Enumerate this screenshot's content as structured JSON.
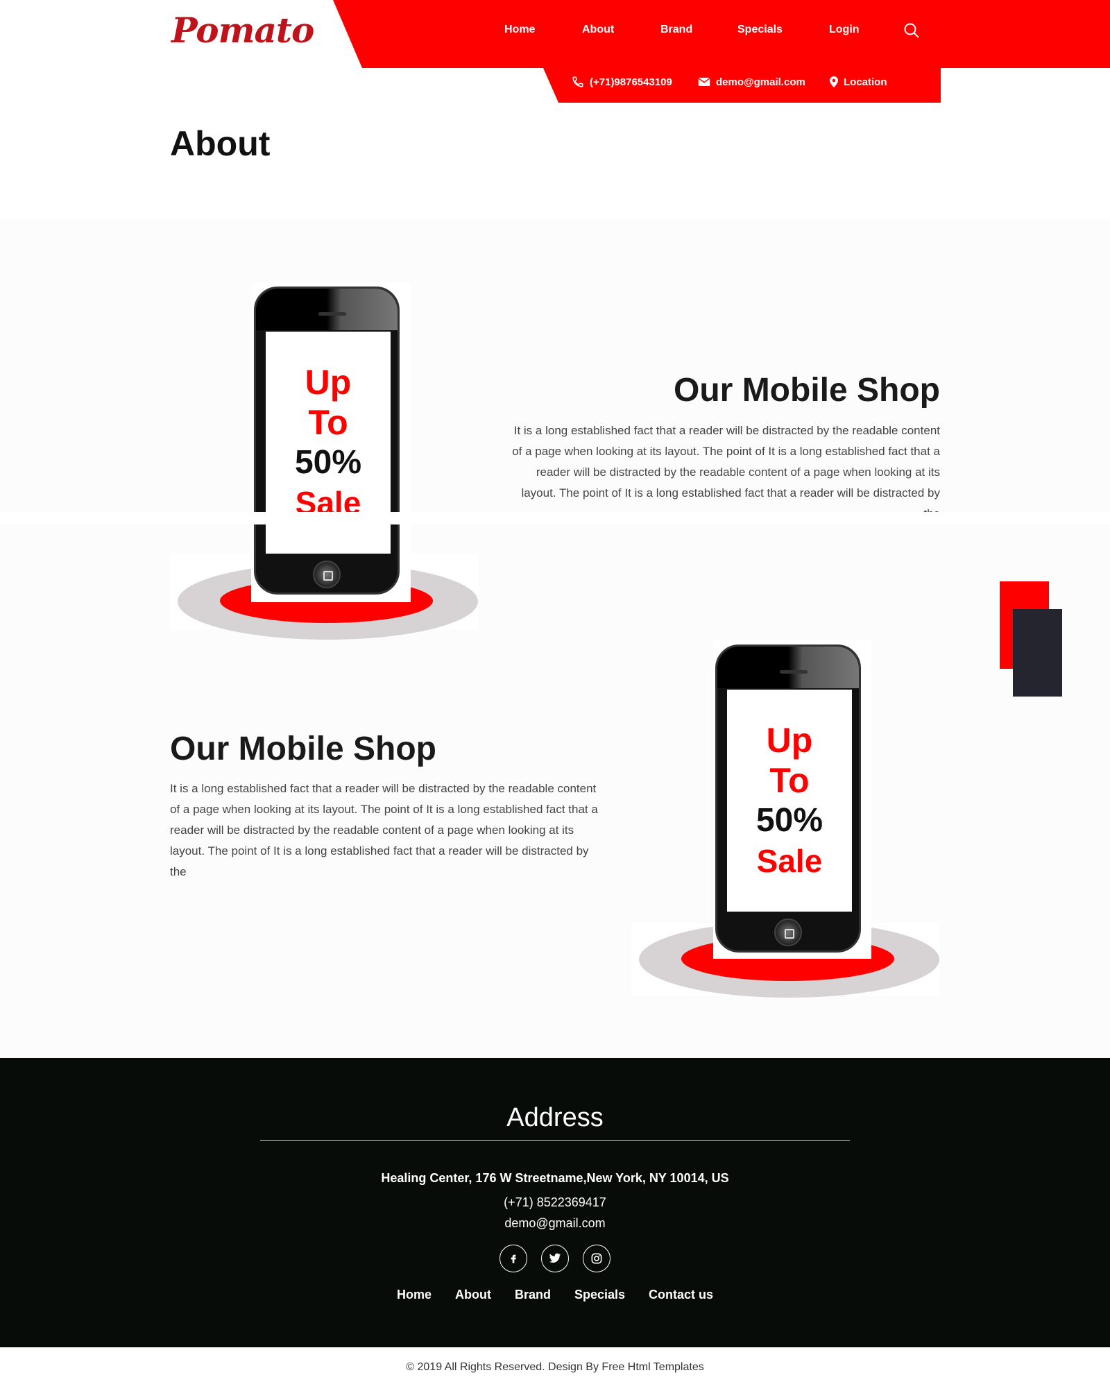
{
  "brand": {
    "logo": "Pomato"
  },
  "nav": {
    "items": [
      "Home",
      "About",
      "Brand",
      "Specials",
      "Login"
    ]
  },
  "contact_bar": {
    "phone": "(+71)9876543109",
    "email": "demo@gmail.com",
    "location": "Location"
  },
  "banner": {
    "title": "About"
  },
  "sections": [
    {
      "title": "Our Mobile Shop",
      "text": "It is a long established fact that a reader will be distracted by the readable content of a page when looking at its layout. The point of It is a long established fact that a reader will be distracted by the readable content of a page when looking at its layout. The point of It is a long established fact that a reader will be distracted by the"
    },
    {
      "title": "Our Mobile Shop",
      "text": "It is a long established fact that a reader will be distracted by the readable content of a page when looking at its layout. The point of It is a long established fact that a reader will be distracted by the readable content of a page when looking at its layout. The point of It is a long established fact that a reader will be distracted by the"
    }
  ],
  "phone_screen": {
    "line1": "Up",
    "line2": "To",
    "line3": "50%",
    "line4": "Sale"
  },
  "footer": {
    "heading": "Address",
    "address": "Healing Center, 176 W Streetname,New York, NY 10014, US",
    "phone": "(+71) 8522369417",
    "email": "demo@gmail.com",
    "social_icons": [
      "facebook-icon",
      "twitter-icon",
      "instagram-icon"
    ],
    "links": [
      "Home",
      "About",
      "Brand",
      "Specials",
      "Contact us"
    ]
  },
  "copyright": "© 2019 All Rights Reserved. Design By Free Html Templates",
  "colors": {
    "accent": "#ff0000",
    "logo": "#c0121b",
    "footer_bg": "#070c09",
    "banner_bg": "#dcdcdc"
  }
}
